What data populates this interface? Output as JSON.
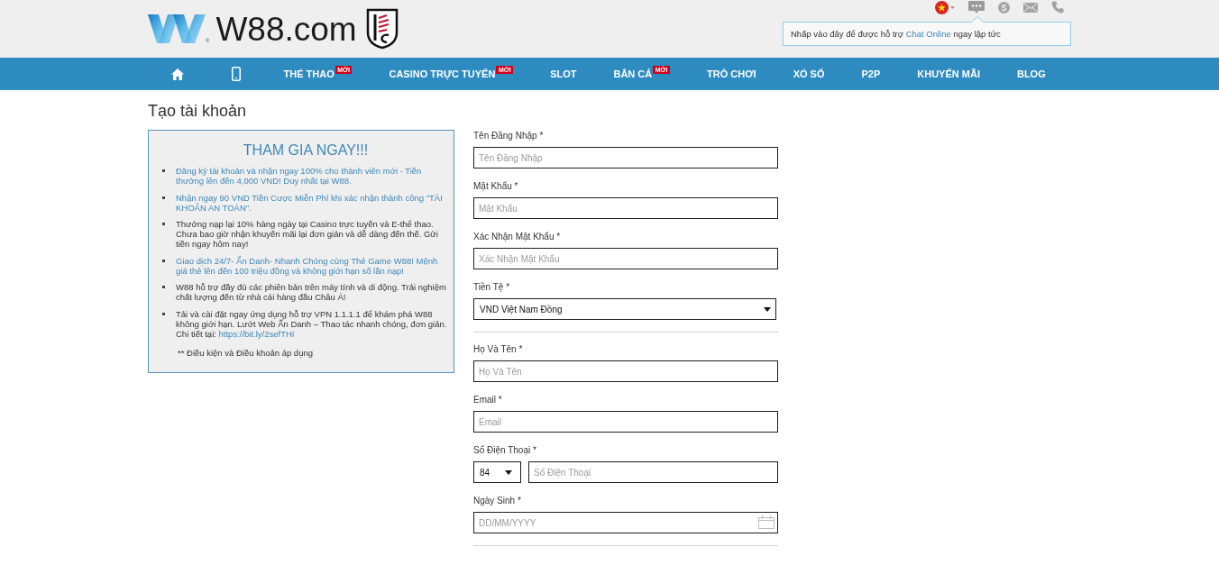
{
  "header": {
    "logo": {
      "registered_mark": "®",
      "text": "W88.com"
    },
    "chat_tooltip": {
      "text": "Nhấp vào đây để được hỗ trợ",
      "link": "Chat Online",
      "text_after": "ngay lập tức"
    }
  },
  "nav": {
    "items": [
      {
        "kind": "home",
        "selected": false
      },
      {
        "kind": "mobile",
        "selected": false
      },
      {
        "kind": "text",
        "label": "THỂ THAO",
        "badge": "MỚI",
        "selected": false
      },
      {
        "kind": "text",
        "label": "CASINO TRỰC TUYẾN",
        "badge": "MỚI",
        "selected": false
      },
      {
        "kind": "text",
        "label": "SLOT",
        "selected": false
      },
      {
        "kind": "text",
        "label": "BẮN CÁ",
        "badge": "MỚI",
        "selected": false
      },
      {
        "kind": "text",
        "label": "TRÒ CHƠI",
        "selected": false
      },
      {
        "kind": "text",
        "label": "XỔ SỐ",
        "selected": false
      },
      {
        "kind": "text",
        "label": "P2P",
        "selected": false
      },
      {
        "kind": "text",
        "label": "KHUYẾN MÃI",
        "selected": false
      },
      {
        "kind": "text",
        "label": "BLOG",
        "selected": false
      }
    ]
  },
  "page_title": "Tạo tài khoản",
  "promo": {
    "title": "THAM GIA NGAY!!!",
    "items": [
      {
        "kind": "link",
        "text": "Đăng ký tài khoản và nhận ngay 100% cho thành viên mới - Tiền thưởng lên đến 4,000 VND! Duy nhất tại W88."
      },
      {
        "kind": "link",
        "text": "Nhận ngay 90 VND Tiền Cược Miễn Phí khi xác nhận thành công \"TÀI KHOẢN AN TOÀN\"."
      },
      {
        "kind": "text",
        "text": "Thưởng nạp lại 10% hàng ngày tại Casino trực tuyến và E-thể thao. Chưa bao giờ nhận khuyến mãi lại đơn giản và dễ dàng đến thế. Gửi tiền ngay hôm nay!"
      },
      {
        "kind": "link",
        "text": "Giao dịch 24/7- Ẩn Danh- Nhanh Chóng cùng Thẻ Game W88! Mệnh giá thẻ lên đến 100 triệu đồng và không giới hạn số lần nạp!"
      },
      {
        "kind": "text",
        "text": "W88 hỗ trợ đầy đủ các phiên bản trên máy tính và di động. Trải nghiệm chất lượng đến từ nhà cái hàng đầu Châu Á!"
      },
      {
        "kind": "text",
        "text": "Tải và cài đặt ngay ứng dụng hỗ trợ VPN 1.1.1.1 để khám phá W88 không giới hạn. Lướt Web Ẩn Danh – Thao tác nhanh chóng, đơn giản. Chi tiết tại:",
        "link": "https://bit.ly/2sefTHI"
      }
    ],
    "footnote": "** Điều kiện và Điều khoản áp dụng"
  },
  "form": {
    "sections": [
      {
        "fields": [
          {
            "kind": "text",
            "label": "Tên Đăng Nhập *",
            "placeholder": "Tên Đăng Nhập"
          },
          {
            "kind": "text",
            "label": "Mật Khẩu *",
            "placeholder": "Mật Khẩu"
          },
          {
            "kind": "text",
            "label": "Xác Nhận Mật Khẩu *",
            "placeholder": "Xác Nhận Mật Khẩu"
          },
          {
            "kind": "select",
            "label": "Tiền Tệ *",
            "value": "VND Việt Nam Đồng"
          }
        ]
      },
      {
        "fields": [
          {
            "kind": "text",
            "label": "Họ Và Tên *",
            "placeholder": "Họ Và Tên"
          },
          {
            "kind": "text",
            "label": "Email *",
            "placeholder": "Email"
          },
          {
            "kind": "phone",
            "label": "Số Điện Thoại *",
            "code": "84",
            "placeholder": "Số Điện Thoại"
          },
          {
            "kind": "date",
            "label": "Ngày Sinh *",
            "placeholder": "DD/MM/YYYY"
          }
        ]
      }
    ]
  }
}
